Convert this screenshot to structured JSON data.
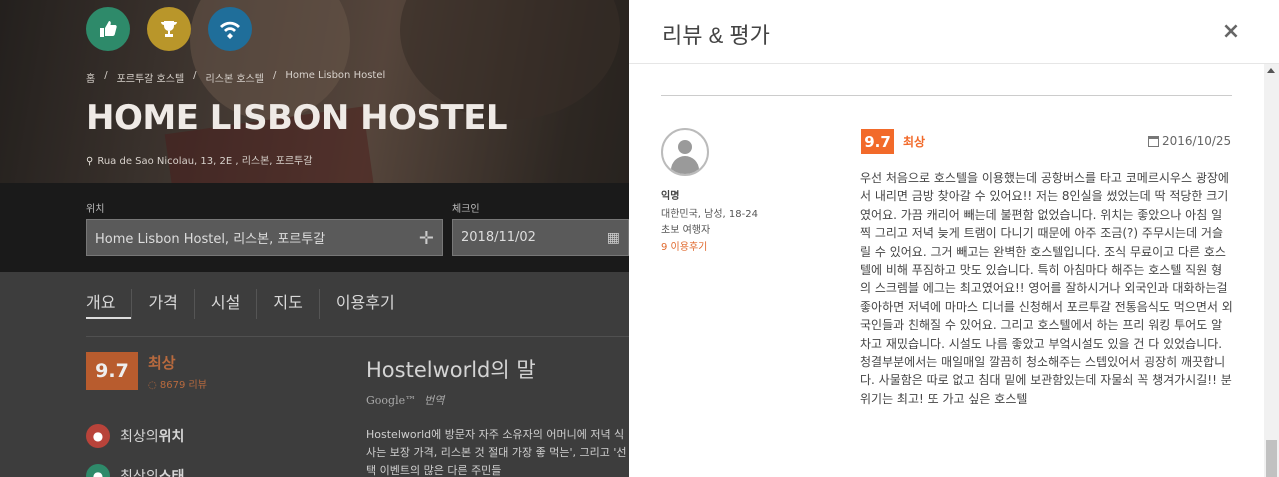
{
  "hero": {
    "breadcrumb": [
      "홈",
      "포르투갈 호스텔",
      "리스본 호스텔",
      "Home Lisbon Hostel"
    ],
    "title": "HOME LISBON HOSTEL",
    "address": "Rua de Sao Nicolau, 13, 2E , 리스본, 포르투갈"
  },
  "search": {
    "location_label": "위치",
    "location_value": "Home Lisbon Hostel, 리스본, 포르투갈",
    "checkin_label": "체크인",
    "checkin_value": "2018/11/02"
  },
  "tabs": [
    "개요",
    "가격",
    "시설",
    "지도",
    "이용후기"
  ],
  "summary": {
    "score": "9.7",
    "rating_word": "최상",
    "review_count": "8679 리뷰",
    "features": [
      {
        "prefix": "최상의 ",
        "bold": "위치"
      },
      {
        "prefix": "최상의 ",
        "bold": "스태"
      }
    ]
  },
  "hostelworld": {
    "title": "Hostelworld의 말",
    "google_label": "Google™",
    "translate_label": "번역",
    "text": "Hostelworld에 방문자 자주 소유자의 어머니에 저녁 식사는 보장 가격, 리스본 것 절대 가장 좋 먹는', 그리고 '선택 이벤트의 많은 다른 주민들"
  },
  "panel": {
    "title": "리뷰 & 평가",
    "close_label": "×"
  },
  "review": {
    "reviewer_name": "익명",
    "reviewer_info": "대한민국, 남성, 18-24",
    "reviewer_type": "초보 여행자",
    "reviewer_count": "9 이용후기",
    "score": "9.7",
    "rating_word": "최상",
    "date": "2016/10/25",
    "text": "우선 처음으로 호스텔을 이용했는데 공항버스를 타고 코메르시우스 광장에서 내리면 금방 찾아갈 수 있어요!! 저는 8인실을 썼었는데 딱 적당한 크기였어요. 가끔 캐리어 빼는데 불편함 없었습니다. 위치는 좋았으나 아침 일찍 그리고 저녁 늦게 트램이 다니기 때문에 아주 조금(?) 주무시는데 거슬릴 수 있어요. 그거 빼고는 완벽한 호스텔입니다. 조식 무료이고 다른 호스텔에 비해 푸짐하고 맛도 있습니다. 특히 아침마다 해주는 호스텔 직원 형의 스크렘블 에그는 최고였어요!! 영어를 잘하시거나 외국인과 대화하는걸 좋아하면 저녁에 마마스 디너를 신청해서 포르투갈 전통음식도 먹으면서 외국인들과 친해질 수 있어요. 그리고 호스텔에서 하는 프리 워킹 투어도 알차고 재밌습니다. 시설도 나름 좋았고 부엌시설도 있을 건 다 있었습니다. 청결부분에서는 매일매일 깔끔히 청소해주는 스텝있어서 굉장히 깨끗합니다. 사물함은 따로 없고 침대 밑에 보관함있는데 자물쇠 꼭 챙겨가시길!! 분위기는 최고! 또 가고 싶은 호스텔"
  },
  "colors": {
    "accent": "#f26a2a",
    "overlay_dark": "#1a1a1a"
  }
}
